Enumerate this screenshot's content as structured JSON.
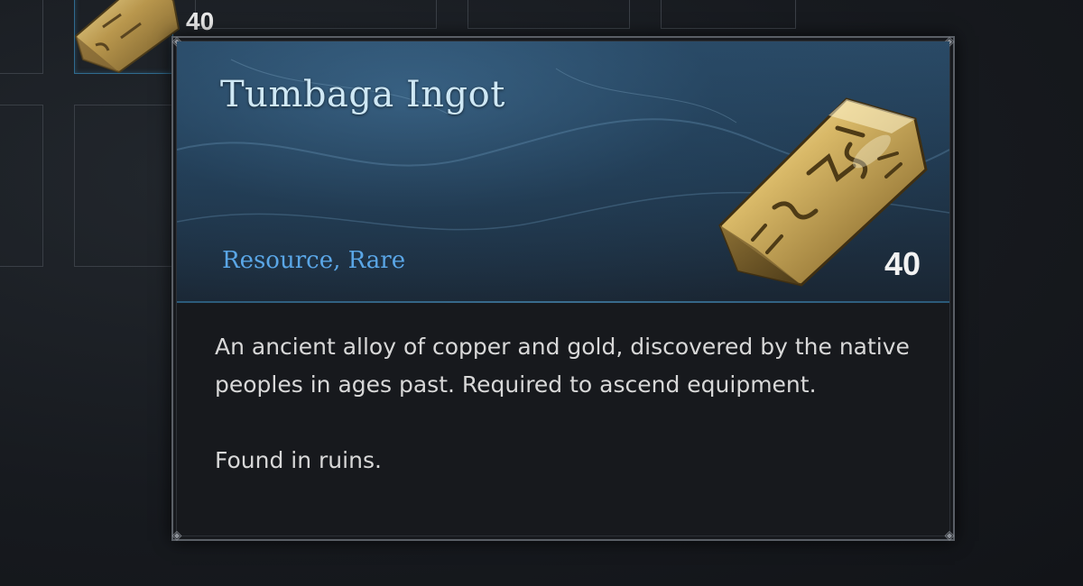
{
  "background": {
    "slot_count": "40"
  },
  "tooltip": {
    "title": "Tumbaga Ingot",
    "type": "Resource, Rare",
    "count": "40",
    "description": "An ancient alloy of copper and gold, discovered by the native peoples in ages past. Required to ascend equipment.",
    "footnote": "Found in ruins.",
    "icon": "gold-ingot-icon"
  },
  "colors": {
    "title": "#cfe8f5",
    "rarity": "#5aa6e6",
    "text": "#d8d8d8",
    "panel": "#17191d",
    "header": "#2a4a66"
  }
}
